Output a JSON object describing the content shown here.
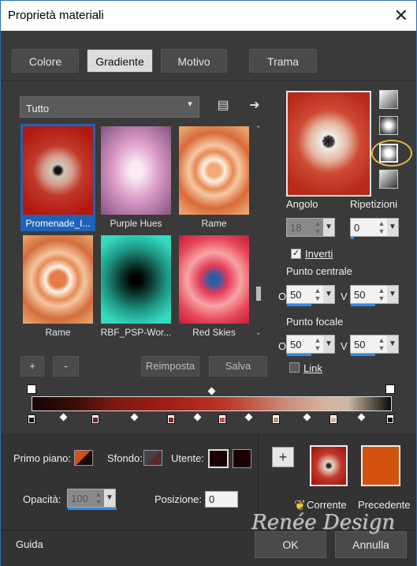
{
  "window": {
    "title": "Proprietà materiali",
    "close_glyph": "✕"
  },
  "tabs": [
    {
      "label": "Colore",
      "active": false
    },
    {
      "label": "Gradiente",
      "active": true
    },
    {
      "label": "Motivo",
      "active": false
    },
    {
      "label": "Trama",
      "active": false
    }
  ],
  "library": {
    "filter": "Tutto",
    "items": [
      {
        "label": "Promenade_I...",
        "selected": true
      },
      {
        "label": "Purple Hues"
      },
      {
        "label": "Rame"
      },
      {
        "label": "Rame"
      },
      {
        "label": "RBF_PSP-Wor..."
      },
      {
        "label": "Red Skies"
      }
    ],
    "add_label": "+",
    "remove_label": "-",
    "reset_label": "Reimposta",
    "save_label": "Salva"
  },
  "settings": {
    "angle_label": "Angolo",
    "angle_value": "18",
    "repeats_label": "Ripetizioni",
    "repeats_value": "0",
    "invert_label": "Inverti",
    "invert_checked": true,
    "center_label": "Punto centrale",
    "center_h_label": "O",
    "center_h": "50",
    "center_v_label": "V",
    "center_v": "50",
    "focal_label": "Punto focale",
    "focal_h_label": "O",
    "focal_h": "50",
    "focal_v_label": "V",
    "focal_v": "50",
    "link_label": "Link",
    "link_checked": false
  },
  "footer": {
    "foreground_label": "Primo piano:",
    "background_label": "Sfondo:",
    "user_label": "Utente:",
    "opacity_label": "Opacità:",
    "opacity_value": "100",
    "position_label": "Posizione:",
    "position_value": "0",
    "add_label": "+",
    "current_label": "Corrente",
    "previous_label": "Precedente",
    "help_label": "Guida",
    "ok_label": "OK",
    "cancel_label": "Annulla",
    "watermark": "Renée Design",
    "colors": {
      "previous": "#d4520f",
      "foreground": "#d4520f",
      "user": "#1a0000"
    }
  }
}
